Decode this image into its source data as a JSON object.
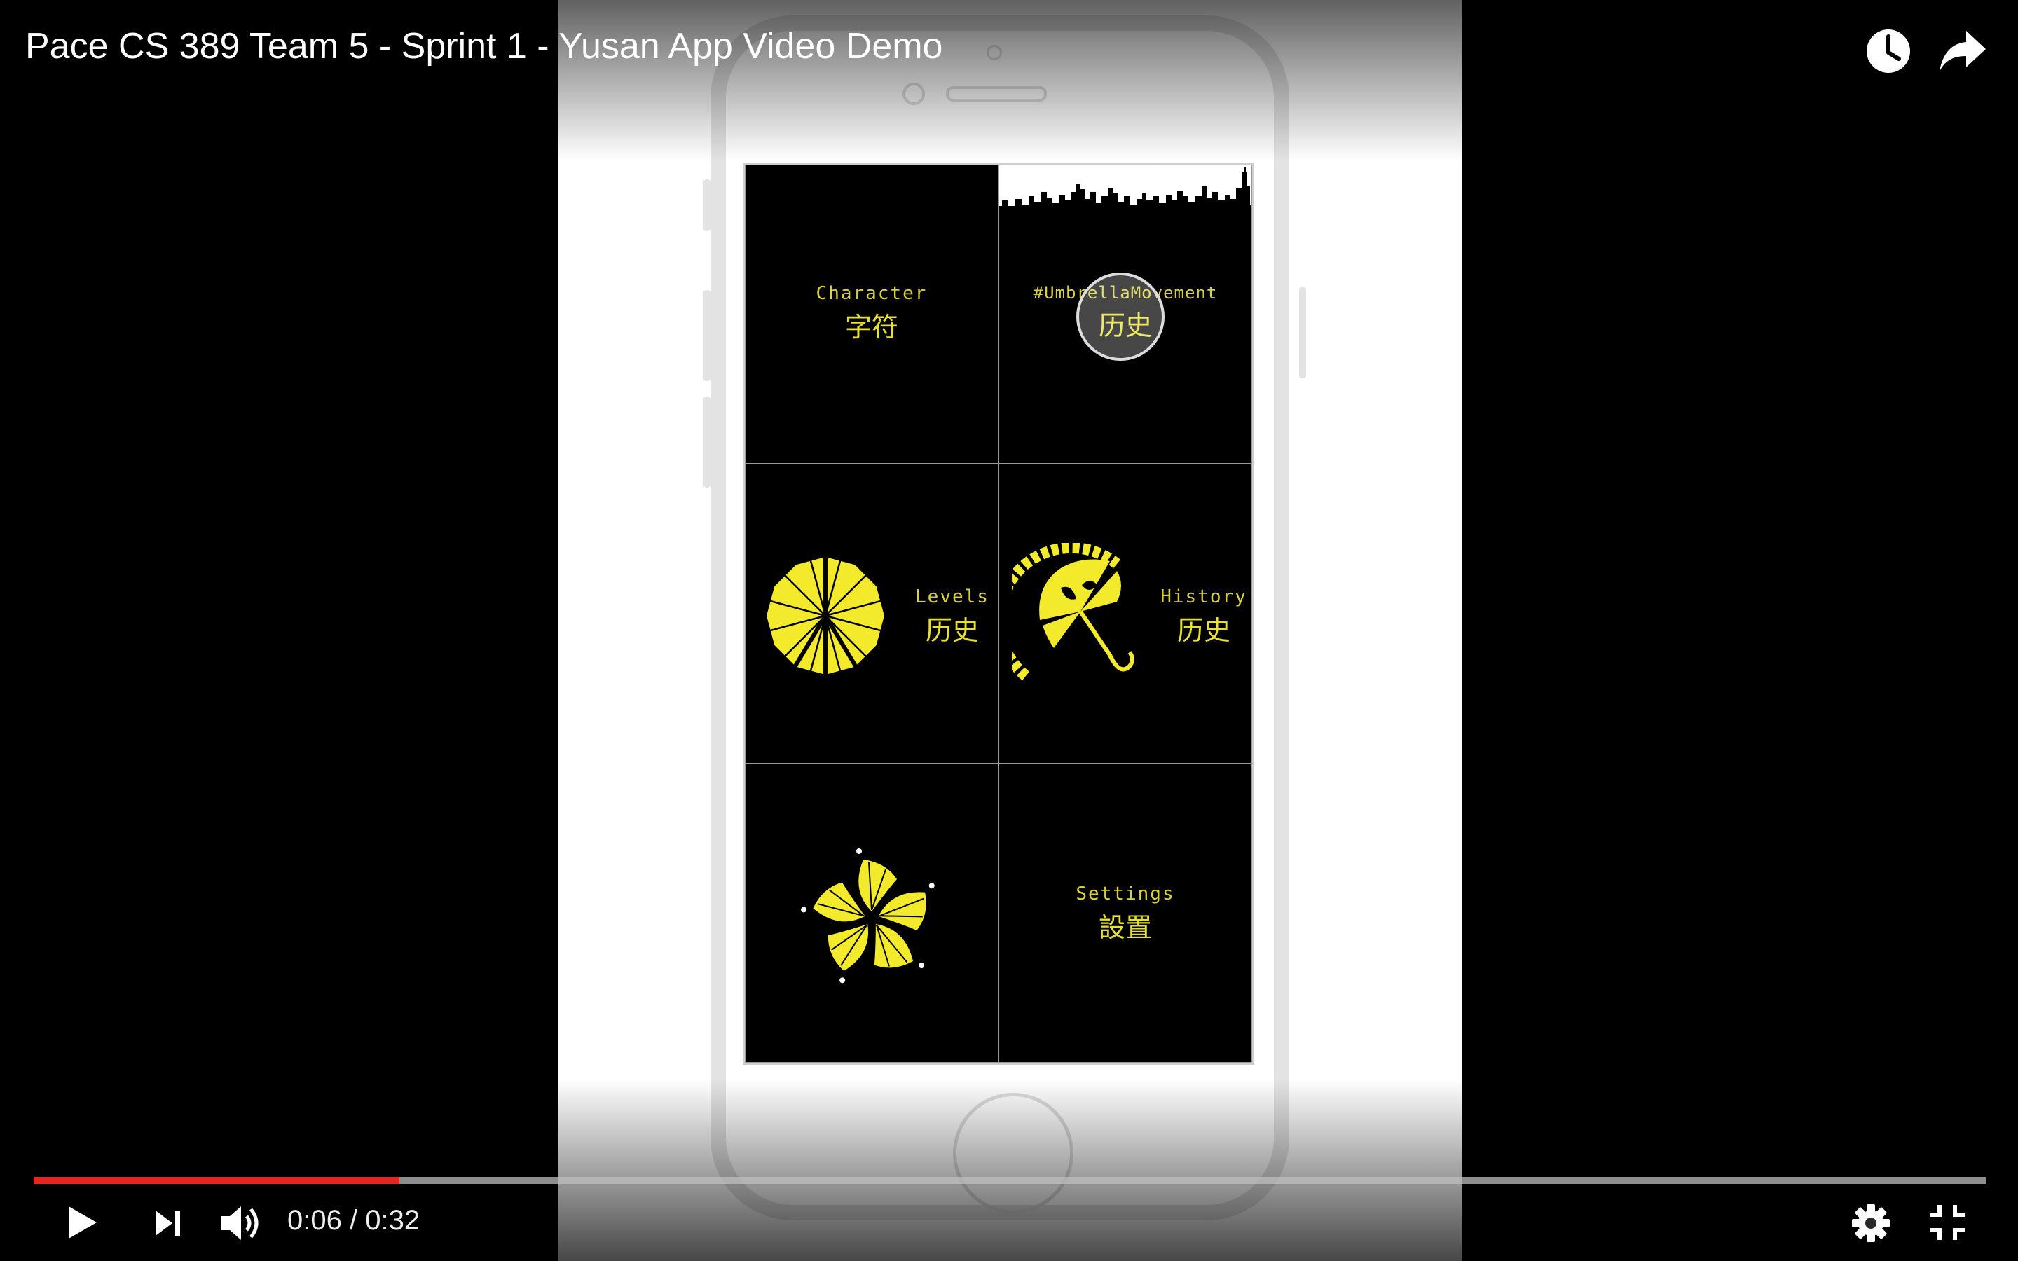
{
  "player": {
    "title": "Pace CS 389 Team 5 - Sprint 1 - Yusan App Video Demo",
    "current_time": "0:06",
    "time_separator": " / ",
    "duration": "0:32",
    "progress_fraction": 0.1875,
    "accent_color": "#e52521",
    "icons": {
      "watch_later": "clock-icon",
      "share": "share-arrow-icon",
      "play": "play-icon",
      "next": "next-icon",
      "volume": "volume-icon",
      "settings": "gear-icon",
      "exit_fullscreen": "exit-fullscreen-icon"
    }
  },
  "app": {
    "accent_color": "#e6e02e",
    "tiles": {
      "character": {
        "en": "Character",
        "zh": "字符"
      },
      "umbrella": {
        "en": "#UmbrellaMovement",
        "zh": "历史"
      },
      "levels": {
        "en": "Levels",
        "zh": "历史"
      },
      "history": {
        "en": "History",
        "zh": "历史"
      },
      "settings": {
        "en": "Settings",
        "zh": "設置"
      }
    }
  }
}
